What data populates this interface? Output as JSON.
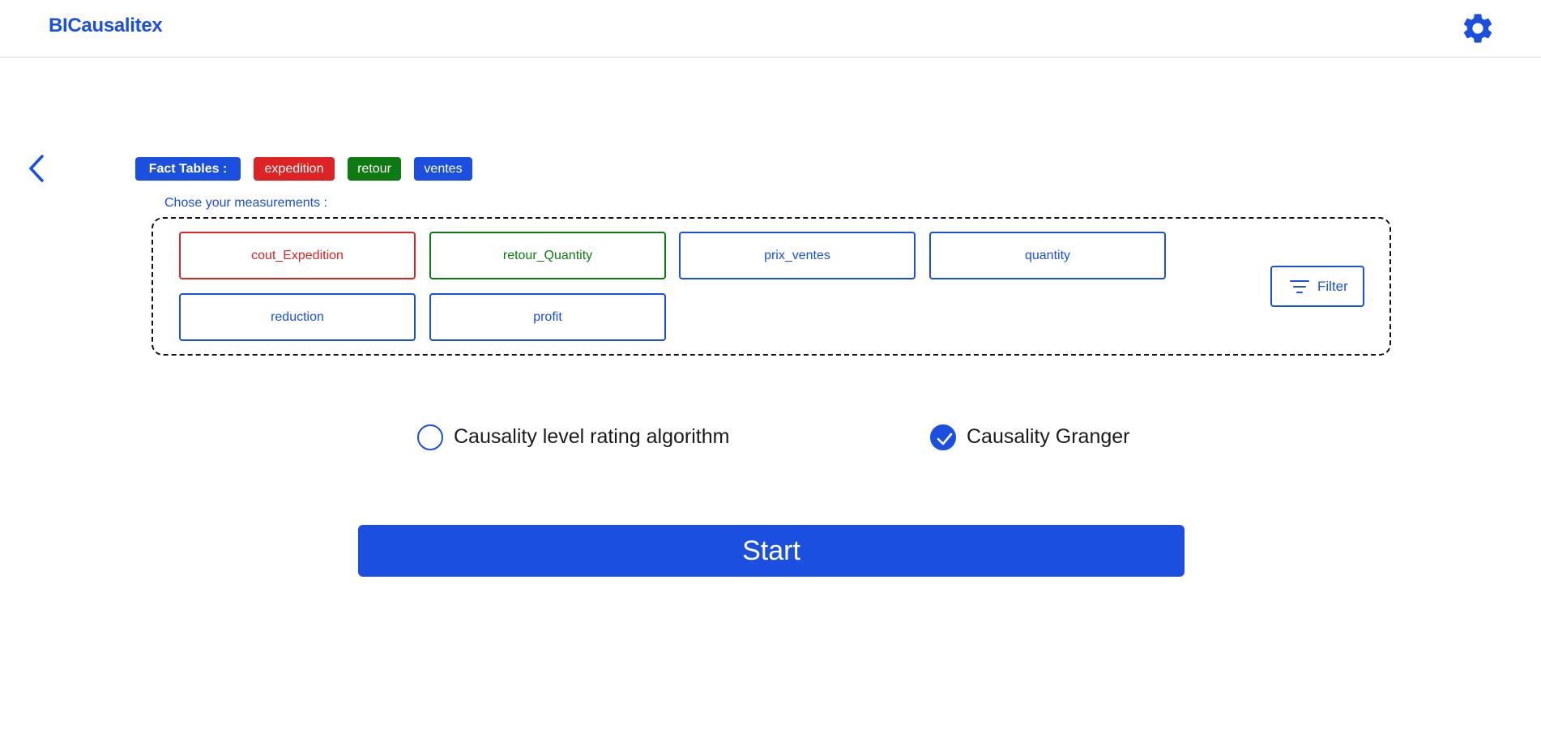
{
  "app": {
    "brand": "BICausalitex",
    "settings_icon": "gear-icon"
  },
  "colors": {
    "primary": "#1a4fe0",
    "red": "#dd2323",
    "green": "#0d7a12"
  },
  "navigation": {
    "back_icon": "chevron-left-icon"
  },
  "fact_tables": {
    "label": "Fact Tables :",
    "items": [
      {
        "name": "expedition",
        "color": "#dd2323"
      },
      {
        "name": "retour",
        "color": "#0d7a12"
      },
      {
        "name": "ventes",
        "color": "#1a4fe0"
      }
    ]
  },
  "measurements": {
    "prompt": "Chose your measurements :",
    "items": [
      {
        "label": "cout_Expedition",
        "table": "expedition"
      },
      {
        "label": "retour_Quantity",
        "table": "retour"
      },
      {
        "label": "prix_ventes",
        "table": "ventes"
      },
      {
        "label": "quantity",
        "table": "ventes"
      },
      {
        "label": "reduction",
        "table": "ventes"
      },
      {
        "label": "profit",
        "table": "ventes"
      }
    ],
    "filter": {
      "label": "Filter",
      "icon": "filter-icon"
    }
  },
  "algorithms": {
    "options": [
      {
        "label": "Causality level rating algorithm",
        "selected": false
      },
      {
        "label": "Causality Granger",
        "selected": true
      }
    ]
  },
  "actions": {
    "start_label": "Start"
  }
}
